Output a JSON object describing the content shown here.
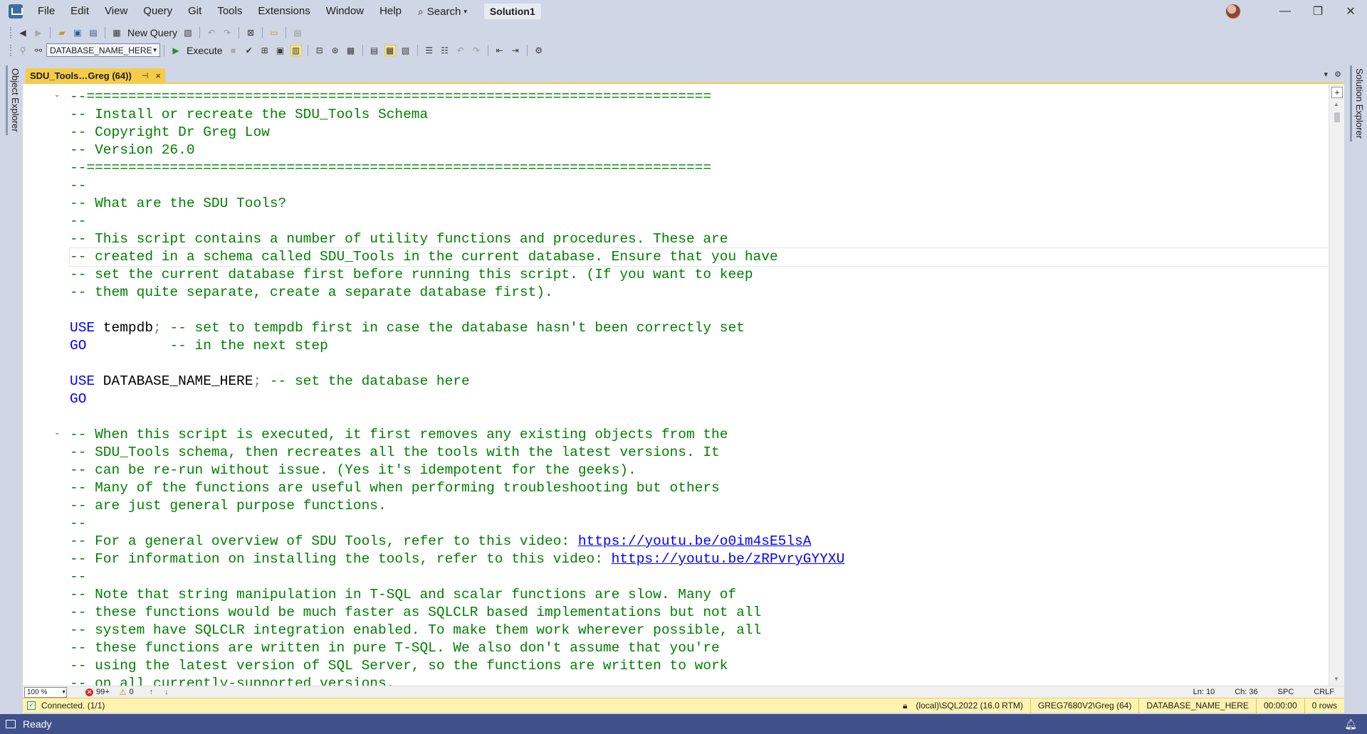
{
  "menu": {
    "items": [
      "File",
      "Edit",
      "View",
      "Query",
      "Git",
      "Tools",
      "Extensions",
      "Window",
      "Help"
    ],
    "search_label": "Search",
    "solution_name": "Solution1"
  },
  "toolbar": {
    "new_query_label": "New Query",
    "database_selector": "DATABASE_NAME_HERE",
    "execute_label": "Execute"
  },
  "side_panels": {
    "left": "Object Explorer",
    "right": "Solution Explorer"
  },
  "tab": {
    "title": "SDU_Tools…Greg (64))",
    "pin_glyph": "⊣",
    "close_glyph": "×"
  },
  "editor": {
    "lines": [
      "--===========================================================================",
      "-- Install or recreate the SDU_Tools Schema",
      "-- Copyright Dr Greg Low",
      "-- Version 26.0",
      "--===========================================================================",
      "--",
      "-- What are the SDU Tools?",
      "--",
      "-- This script contains a number of utility functions and procedures. These are",
      "-- created in a schema called SDU_Tools in the current database. Ensure that you have",
      "-- set the current database first before running this script. (If you want to keep",
      "-- them quite separate, create a separate database first).",
      "",
      "USE tempdb; -- set to tempdb first in case the database hasn't been correctly set",
      "GO          -- in the next step",
      "",
      "USE DATABASE_NAME_HERE; -- set the database here",
      "GO",
      "",
      "-- When this script is executed, it first removes any existing objects from the",
      "-- SDU_Tools schema, then recreates all the tools with the latest versions. It",
      "-- can be re-run without issue. (Yes it's idempotent for the geeks).",
      "-- Many of the functions are useful when performing troubleshooting but others",
      "-- are just general purpose functions.",
      "--",
      "-- For a general overview of SDU Tools, refer to this video: https://youtu.be/o0im4sE5lsA",
      "-- For information on installing the tools, refer to this video: https://youtu.be/zRPvryGYYXU",
      "--",
      "-- Note that string manipulation in T-SQL and scalar functions are slow. Many of",
      "-- these functions would be much faster as SQLCLR based implementations but not all",
      "-- system have SQLCLR integration enabled. To make them work wherever possible, all",
      "-- these functions are written in pure T-SQL. We also don't assume that you're",
      "-- using the latest version of SQL Server, so the functions are written to work",
      "-- on all currently-supported versions."
    ],
    "current_line_index": 9
  },
  "editor_status": {
    "zoom": "100 %",
    "errors": "99+",
    "warnings": "0",
    "line": "Ln: 10",
    "column": "Ch: 36",
    "spc": "SPC",
    "eol": "CRLF"
  },
  "query_status": {
    "connection": "Connected. (1/1)",
    "server": "(local)\\SQL2022 (16.0 RTM)",
    "user": "GREG7680V2\\Greg (64)",
    "database": "DATABASE_NAME_HERE",
    "elapsed": "00:00:00",
    "rows": "0 rows"
  },
  "app_status": {
    "text": "Ready"
  },
  "colors": {
    "comment": "#008000",
    "keyword": "#0000ff",
    "tab_active": "#f5cc4a",
    "status_bar": "#40508a",
    "query_status_bg": "#fff3b0"
  }
}
